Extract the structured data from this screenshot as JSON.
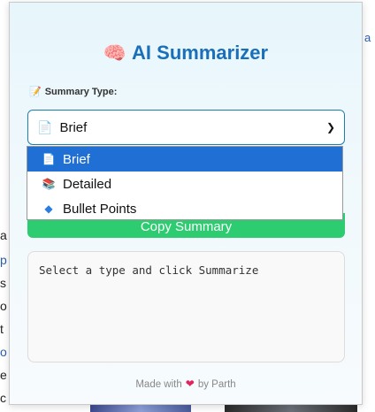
{
  "header": {
    "title": "AI Summarizer",
    "title_icon": "brain-icon"
  },
  "summary_type": {
    "label": "Summary Type:",
    "label_icon": "pencil-icon",
    "selected": "Brief",
    "selected_icon": "document-icon",
    "options": [
      {
        "label": "Brief",
        "icon": "document-icon",
        "selected": true
      },
      {
        "label": "Detailed",
        "icon": "books-icon",
        "selected": false
      },
      {
        "label": "Bullet Points",
        "icon": "blue-diamond-icon",
        "selected": false
      }
    ]
  },
  "copy_button": {
    "label": "Copy Summary"
  },
  "output": {
    "text": "Select a type and click Summarize"
  },
  "footer": {
    "prefix": "Made with",
    "suffix": "by Parth"
  },
  "colors": {
    "accent": "#1a6fba",
    "selection": "#1f6fd4",
    "copy_button": "#2ecc71"
  }
}
